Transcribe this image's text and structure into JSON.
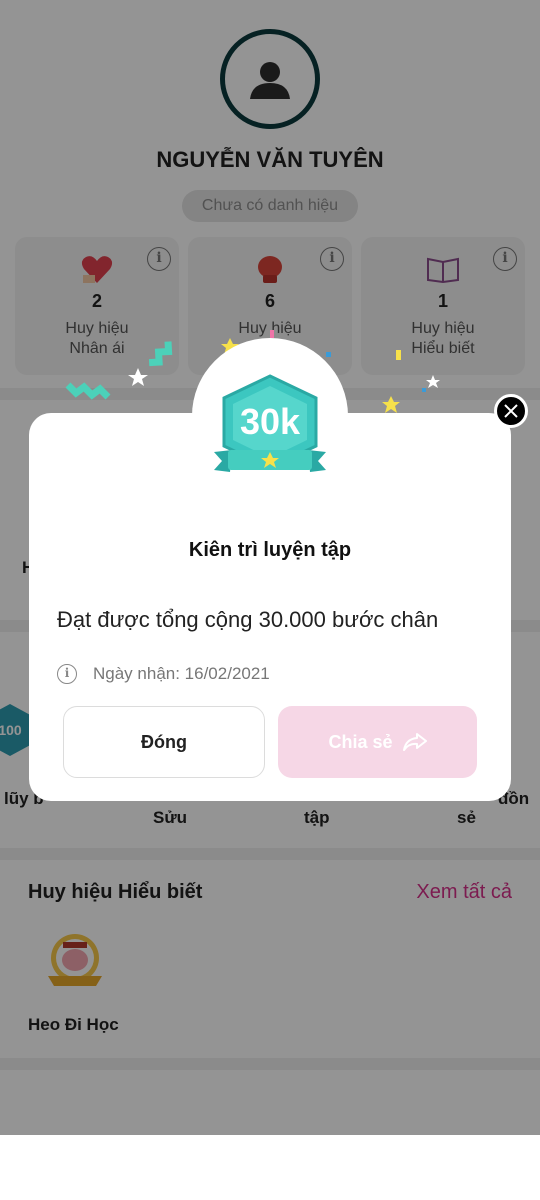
{
  "profile": {
    "name": "NGUYỄN VĂN TUYÊN",
    "title_badge": "Chưa có danh hiệu"
  },
  "summary_cards": [
    {
      "count": "2",
      "label_line1": "Huy hiệu",
      "label_line2": "Nhân ái",
      "icon": "heart-gift-icon"
    },
    {
      "count": "6",
      "label_line1": "Huy hiệu",
      "label_line2": "",
      "icon": "boxing-glove-icon"
    },
    {
      "count": "1",
      "label_line1": "Huy hiệu",
      "label_line2": "Hiểu biết",
      "icon": "book-icon"
    }
  ],
  "background_fragments": {
    "left_h": "H",
    "luy": "lũy b",
    "suu": "Sửu",
    "tap": "tập",
    "don": "đồn",
    "se": "sẻ",
    "badge_100": "100"
  },
  "knowledge_section": {
    "title": "Huy hiệu Hiểu biết",
    "see_all": "Xem tất cả",
    "items": [
      {
        "label": "Heo Đi Học",
        "icon": "pig-student-badge-icon"
      }
    ]
  },
  "modal": {
    "badge_text": "30k",
    "title": "Kiên trì luyện tập",
    "description": "Đạt được tổng cộng 30.000 bước chân",
    "date_label": "Ngày nhận: 16/02/2021",
    "close_button": "Đóng",
    "share_button": "Chia sẻ"
  },
  "colors": {
    "accent_pink": "#d6318a",
    "share_disabled": "#f6d7e6",
    "badge_teal": "#3cc7c0"
  }
}
